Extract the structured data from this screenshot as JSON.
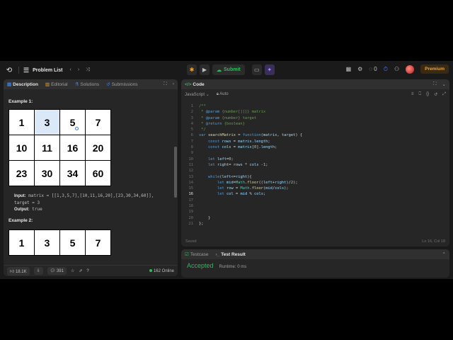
{
  "topbar": {
    "problem_list": "Problem List",
    "submit": "Submit",
    "premium": "Premium",
    "streak": "0"
  },
  "left_tabs": [
    "Description",
    "Editorial",
    "Solutions",
    "Submissions"
  ],
  "examples": [
    {
      "title": "Example 1:",
      "matrix": [
        [
          "1",
          "3",
          "5",
          "7"
        ],
        [
          "10",
          "11",
          "16",
          "20"
        ],
        [
          "23",
          "30",
          "34",
          "60"
        ]
      ],
      "input_label": "Input:",
      "input_value": "matrix = [[1,3,5,7],[10,11,16,20],[23,30,34,60]],",
      "input_value2": "target = 3",
      "output_label": "Output:",
      "output_value": "true"
    },
    {
      "title": "Example 2:",
      "matrix": [
        [
          "1",
          "3",
          "5",
          "7"
        ]
      ]
    }
  ],
  "footer": {
    "likes": "18.1K",
    "comments": "391",
    "online": "162 Online"
  },
  "code": {
    "tab": "Code",
    "language": "JavaScript",
    "auto": "Auto",
    "saved": "Saved",
    "cursor": "Ln 16, Col 18"
  },
  "result": {
    "testcase_tab": "Testcase",
    "result_tab": "Test Result",
    "status": "Accepted",
    "runtime": "Runtime: 0 ms"
  },
  "icons": {
    "logo": "leetcode-logo-icon",
    "list": "list-icon",
    "prev": "chevron-left-icon",
    "next": "chevron-right-icon",
    "shuffle": "shuffle-icon"
  },
  "colors": {
    "accent_green": "#2cbb5d",
    "premium": "#ffa116",
    "highlight_cell": "#dbe8f8"
  }
}
